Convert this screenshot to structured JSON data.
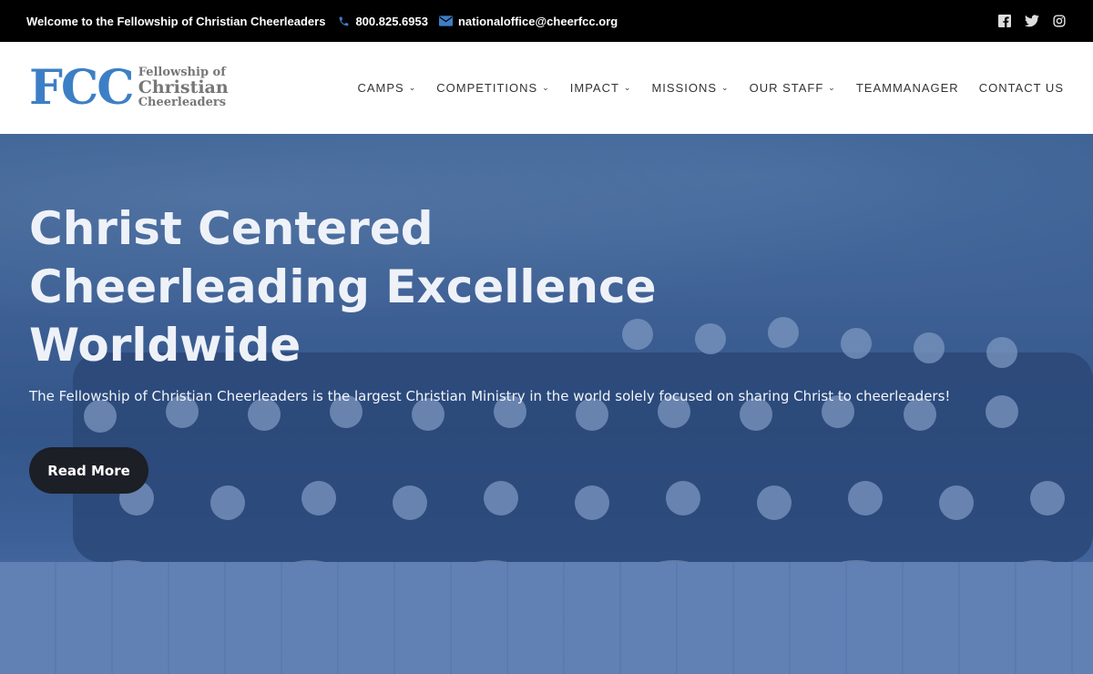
{
  "topbar": {
    "welcome": "Welcome to the Fellowship of Christian Cheerleaders",
    "phone": "800.825.6953",
    "email": "nationaloffice@cheerfcc.org",
    "social": [
      "facebook-icon",
      "twitter-icon",
      "instagram-icon"
    ]
  },
  "logo": {
    "mark": "FCC",
    "line1": "Fellowship of",
    "line2": "Christian",
    "line3": "Cheerleaders",
    "color": "#3d7fc6"
  },
  "nav": {
    "items": [
      {
        "label": "CAMPS",
        "dropdown": true
      },
      {
        "label": "COMPETITIONS",
        "dropdown": true
      },
      {
        "label": "IMPACT",
        "dropdown": true
      },
      {
        "label": "MISSIONS",
        "dropdown": true
      },
      {
        "label": "OUR STAFF",
        "dropdown": true
      },
      {
        "label": "TEAMMANAGER",
        "dropdown": false
      },
      {
        "label": "CONTACT US",
        "dropdown": false
      }
    ]
  },
  "hero": {
    "title": "Christ Centered Cheerleading Excellence Worldwide",
    "subtitle": "The Fellowship of Christian Cheerleaders is the largest Christian Ministry in the world solely focused on sharing Christ to cheerleaders!",
    "button_label": "Read More",
    "overlay_color": "#3c64aa"
  }
}
